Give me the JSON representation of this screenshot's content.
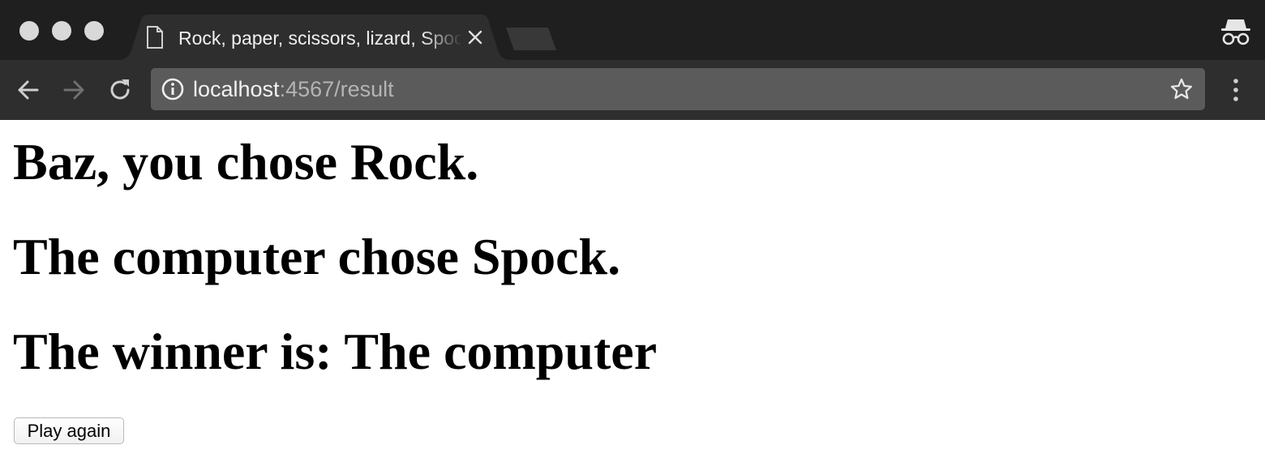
{
  "browser": {
    "window_controls": [
      "close",
      "minimize",
      "maximize"
    ],
    "tab": {
      "title": "Rock, paper, scissors, lizard, Spock",
      "icon": "page-icon",
      "close_icon": "close-icon"
    },
    "new_tab_icon": "new-tab-icon",
    "incognito_icon": "incognito-icon",
    "toolbar": {
      "back_icon": "back-arrow-icon",
      "forward_icon": "forward-arrow-icon",
      "reload_icon": "reload-icon",
      "info_icon": "info-icon",
      "url_host": "localhost",
      "url_path": ":4567/result",
      "bookmark_icon": "star-icon",
      "menu_icon": "kebab-menu-icon"
    }
  },
  "page": {
    "choice_heading": "Baz, you chose Rock.",
    "computer_heading": "The computer chose Spock.",
    "winner_heading": "The winner is: The computer",
    "play_again_label": "Play again"
  },
  "colors": {
    "tabbar_bg": "#1f1f1f",
    "tab_bg": "#2e2e2e",
    "omnibox_bg": "#5b5b5b",
    "page_bg": "#ffffff"
  }
}
